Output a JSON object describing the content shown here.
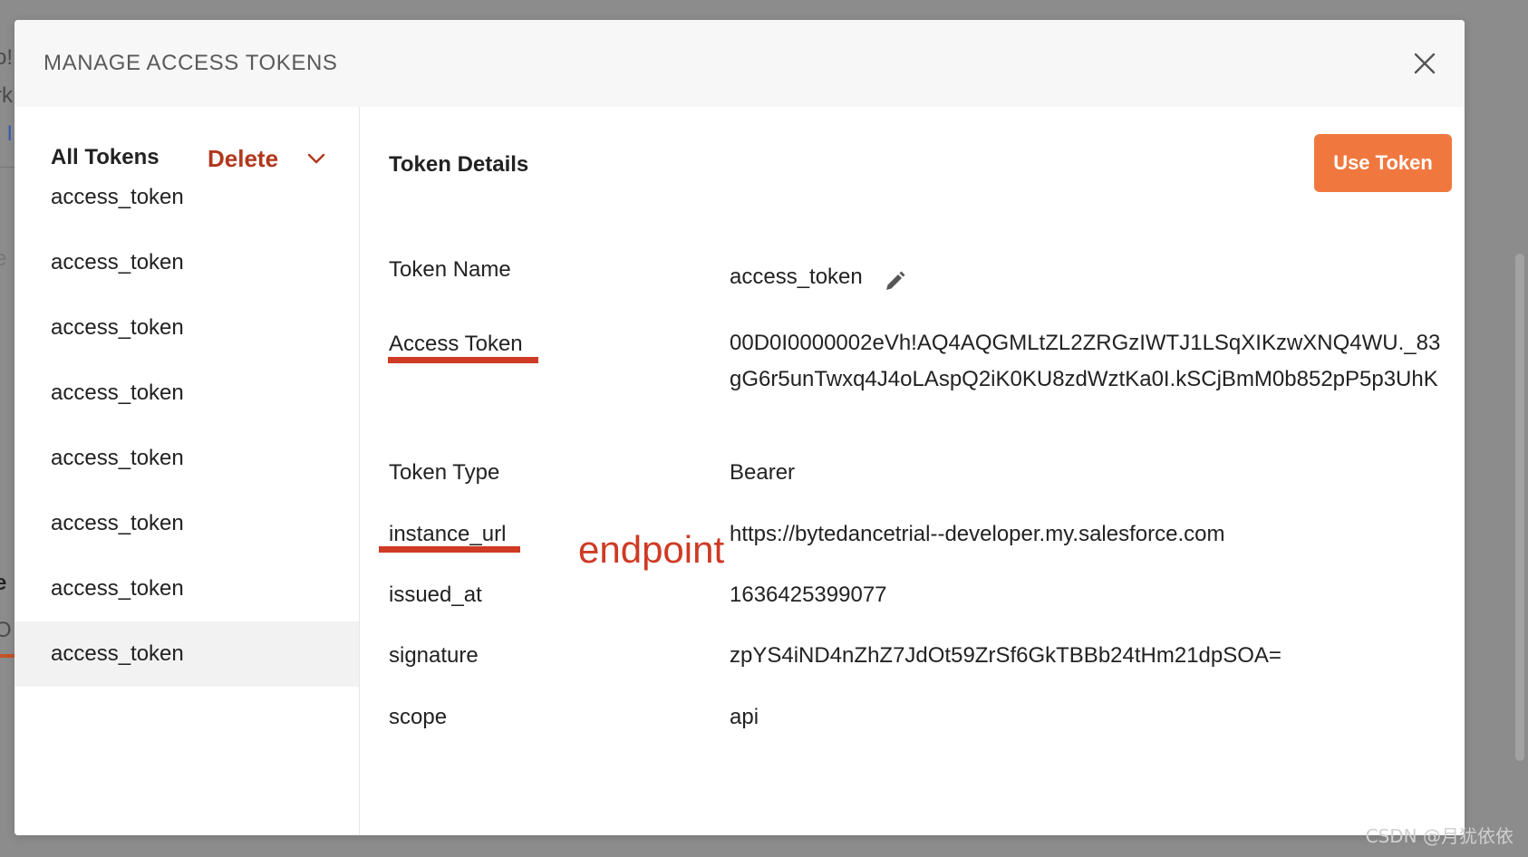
{
  "modal": {
    "title": "MANAGE ACCESS TOKENS"
  },
  "sidebar": {
    "header": "All Tokens",
    "delete_label": "Delete",
    "tokens": [
      "access_token",
      "access_token",
      "access_token",
      "access_token",
      "access_token",
      "access_token",
      "access_token",
      "access_token"
    ],
    "selected_index": 7
  },
  "details": {
    "title": "Token Details",
    "use_token_label": "Use Token",
    "fields": {
      "token_name": {
        "label": "Token Name",
        "value": "access_token"
      },
      "access_token": {
        "label": "Access Token",
        "value": "00D0I0000002eVh!AQ4AQGMLtZL2ZRGzIWTJ1LSqXIKzwXNQ4WU._83gG6r5unTwxq4J4oLAspQ2iK0KU8zdWztKa0I.kSCjBmM0b852pP5p3UhK"
      },
      "token_type": {
        "label": "Token Type",
        "value": "Bearer"
      },
      "instance_url": {
        "label": "instance_url",
        "value": "https://bytedancetrial--developer.my.salesforce.com"
      },
      "issued_at": {
        "label": "issued_at",
        "value": "1636425399077"
      },
      "signature": {
        "label": "signature",
        "value": "zpYS4iND4nZhZ7JdOt59ZrSf6GkTBBb24tHm21dpSOA="
      },
      "scope": {
        "label": "scope",
        "value": "api"
      }
    }
  },
  "annotation": {
    "endpoint_label": "endpoint",
    "color": "#cf3a24"
  },
  "background_fragments": [
    "o!",
    "rk",
    ". I",
    "e",
    "i",
    "e",
    "O"
  ],
  "watermark": "CSDN @月犹依依",
  "colors": {
    "accent": "#f0783f",
    "delete": "#b2361c",
    "overlay": "#8c8c8c"
  }
}
